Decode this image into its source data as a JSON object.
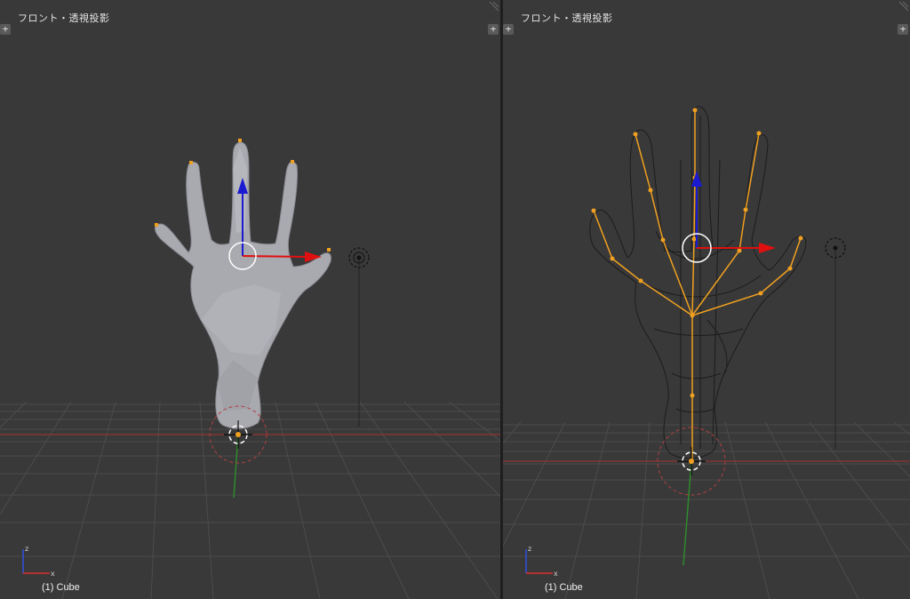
{
  "viewports": [
    {
      "title": "フロント・透視投影",
      "object_label": "(1) Cube",
      "mode": "solid",
      "axis_labels": {
        "z": "z",
        "x": "x"
      }
    },
    {
      "title": "フロント・透視投影",
      "object_label": "(1) Cube",
      "mode": "wireframe-with-armature",
      "axis_labels": {
        "z": "z",
        "x": "x"
      }
    }
  ],
  "icons": {
    "plus": "+",
    "corner": "resize-corner-icon"
  },
  "colors": {
    "background": "#393939",
    "grid": "#4a4a4a",
    "x_axis": "#b03030",
    "y_axis": "#2e8b2e",
    "z_arrow": "#1a1ad0",
    "x_arrow": "#e01010",
    "bone": "#f0a020",
    "mesh_solid": "#a8a8ae",
    "wireframe": "#1c1c1c"
  }
}
